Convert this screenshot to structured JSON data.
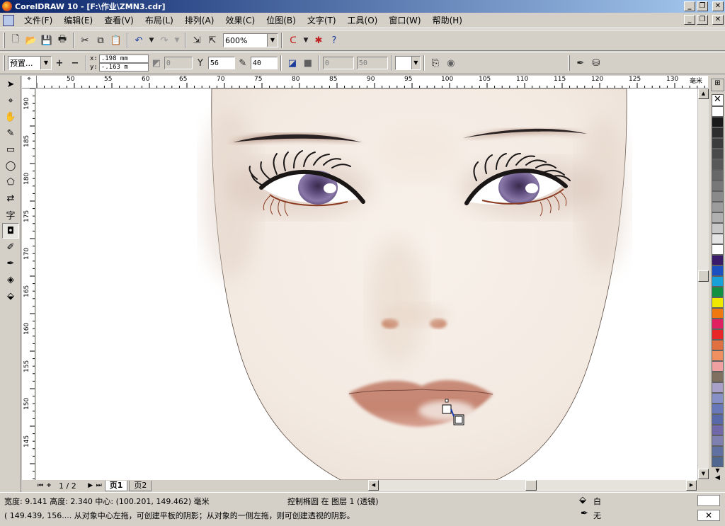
{
  "app": {
    "title": "CorelDRAW 10 - [F:\\作业\\ZMN3.cdr]",
    "window_buttons": [
      "_",
      "❐",
      "✕"
    ]
  },
  "menubar": {
    "items": [
      "文件(F)",
      "编辑(E)",
      "查看(V)",
      "布局(L)",
      "排列(A)",
      "效果(C)",
      "位图(B)",
      "文字(T)",
      "工具(O)",
      "窗口(W)",
      "帮助(H)"
    ]
  },
  "toolbar1": {
    "zoom_value": "600%"
  },
  "toolbar2": {
    "preset_value": "预置...",
    "x_label": "x:",
    "x_value": ".198 mm",
    "y_label": "y:",
    "y_value": "-.163 m",
    "offset_value": "0",
    "opacity_value": "56",
    "feather_value": "40",
    "fade_value": "0",
    "stretch_value": "50"
  },
  "ruler": {
    "unit": "毫米",
    "top_ticks": [
      "50",
      "55",
      "60",
      "65",
      "70",
      "75",
      "80",
      "85",
      "90",
      "95",
      "100",
      "105",
      "110",
      "115",
      "120",
      "125",
      "130"
    ],
    "left_ticks": [
      "190",
      "185",
      "180",
      "175",
      "170",
      "165",
      "160",
      "155",
      "150",
      "145"
    ]
  },
  "pages": {
    "counter": "1 / 2",
    "tabs": [
      "页1",
      "页2"
    ],
    "active": "页1"
  },
  "status": {
    "line1": "宽度: 9.141  高度: 2.340  中心: (100.201, 149.462)  毫米",
    "object_info": "控制椭圆 在 图层 1  (透镜)",
    "line2": "( 149.439, 156.... 从对象中心左拖，可创建平板的阴影；从对象的一侧左拖，则可创建透视的阴影。",
    "fill_label": "白",
    "outline_label": "无"
  },
  "palette": {
    "colors": [
      "#ffffff",
      "#1a1a1a",
      "#2e2e2e",
      "#3c3c3c",
      "#4a4a4a",
      "#585858",
      "#686868",
      "#787878",
      "#8a8a8a",
      "#9c9c9c",
      "#b0b0b0",
      "#c8c8c8",
      "#e4e4e4",
      "#ffffff",
      "#3a1a6a",
      "#1a50c0",
      "#18a0d8",
      "#109040",
      "#f0e800",
      "#f07810",
      "#e02060",
      "#e82828",
      "#e07040",
      "#f09060",
      "#f0a0a0",
      "#807060",
      "#a8a0c8",
      "#8890c8",
      "#6878b8",
      "#5868a8",
      "#7068a8",
      "#8080b0",
      "#6070a0",
      "#506890"
    ]
  }
}
